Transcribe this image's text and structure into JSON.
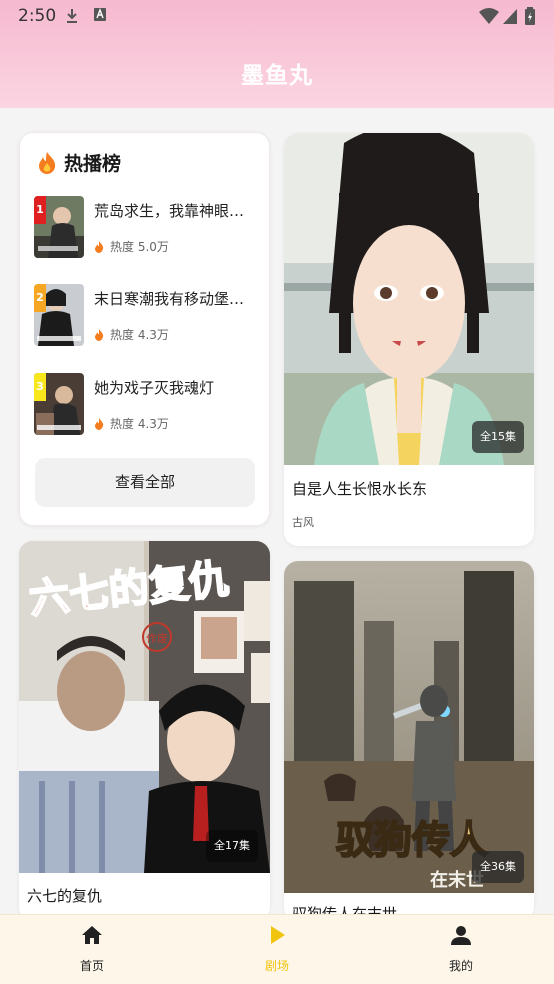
{
  "status_bar": {
    "time": "2:50",
    "icons": [
      "download-icon",
      "text-a-icon",
      "wifi-icon",
      "signal-icon",
      "battery-icon"
    ]
  },
  "app": {
    "title": "墨鱼丸"
  },
  "hot_list": {
    "title": "热播榜",
    "icon": "fire-icon",
    "items": [
      {
        "rank": "1",
        "title": "荒岛求生，我靠神眼…",
        "heat": "热度 5.0万",
        "badge_color": "#e02020"
      },
      {
        "rank": "2",
        "title": "末日寒潮我有移动堡…",
        "heat": "热度 4.3万",
        "badge_color": "#f5a623"
      },
      {
        "rank": "3",
        "title": "她为戏子灭我魂灯",
        "heat": "热度 4.3万",
        "badge_color": "#f8e71c"
      }
    ],
    "view_all": "查看全部"
  },
  "cards": [
    {
      "title": "自是人生长恨水长东",
      "episodes": "全15集",
      "tag": "古风"
    },
    {
      "title": "六七的复仇",
      "episodes": "全17集",
      "poster_text": "六七的复仇",
      "poster_stamp": "作废"
    },
    {
      "title": "驭狗传人在末世",
      "episodes": "全36集",
      "poster_text": "驭狗传人",
      "poster_sub": "在末世"
    }
  ],
  "bottom_nav": {
    "items": [
      {
        "label": "首页",
        "icon": "home-icon"
      },
      {
        "label": "剧场",
        "icon": "play-icon"
      },
      {
        "label": "我的",
        "icon": "person-icon"
      }
    ],
    "active_color": "#f1c40f"
  }
}
